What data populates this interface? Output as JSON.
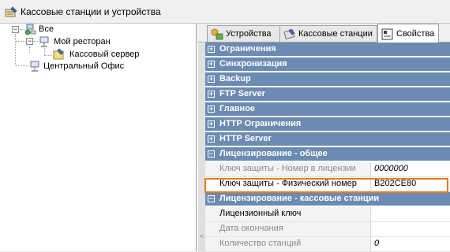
{
  "window": {
    "title": "Кассовые станции и устройства",
    "icon": "pencil-form-icon"
  },
  "tree": {
    "root": {
      "label": "Все",
      "icon": "network-globe-icon",
      "expander": "−"
    },
    "child1": {
      "label": "Мой ресторан",
      "icon": "network-node-icon",
      "expander": "−"
    },
    "child1_1": {
      "label": "Кассовый сервер",
      "icon": "folder-server-icon"
    },
    "child2": {
      "label": "Центральный Офис",
      "icon": "network-node-icon"
    }
  },
  "tabs": [
    {
      "label": "Устройства",
      "icon": "devices-icon",
      "active": false
    },
    {
      "label": "Кассовые станции",
      "icon": "cash-station-icon",
      "active": false
    },
    {
      "label": "Свойства",
      "icon": "properties-icon",
      "active": true
    }
  ],
  "properties": {
    "categories": [
      {
        "label": "Ограничения",
        "expander": "+"
      },
      {
        "label": "Синхронизация",
        "expander": "+"
      },
      {
        "label": "Backup",
        "expander": "+"
      },
      {
        "label": "FTP Server",
        "expander": "+"
      },
      {
        "label": "Главное",
        "expander": "+"
      },
      {
        "label": "HTTP Ограничения",
        "expander": "+"
      },
      {
        "label": "HTTP Server",
        "expander": "+"
      },
      {
        "label": "Лицензирование - общее",
        "expander": "−"
      },
      {
        "label": "Лицензирование - кассовые станции",
        "expander": "−"
      }
    ],
    "license_general_rows": [
      {
        "name": "Ключ защиты - Номер в лицензии",
        "value": "0000000",
        "name_grey": true
      },
      {
        "name": "Ключ защиты - Физический номер",
        "value": "B202CE80",
        "name_grey": false
      }
    ],
    "license_station_rows": [
      {
        "name": "Лицензионный ключ",
        "value": "",
        "name_grey": false
      },
      {
        "name": "Дата окончания",
        "value": "",
        "name_grey": true
      },
      {
        "name": "Количество станций",
        "value": "0",
        "name_grey": true
      }
    ],
    "gutter_arrow": "<"
  },
  "colors": {
    "category_bg": "#6b8bb3",
    "highlight_border": "#e87a1e"
  }
}
